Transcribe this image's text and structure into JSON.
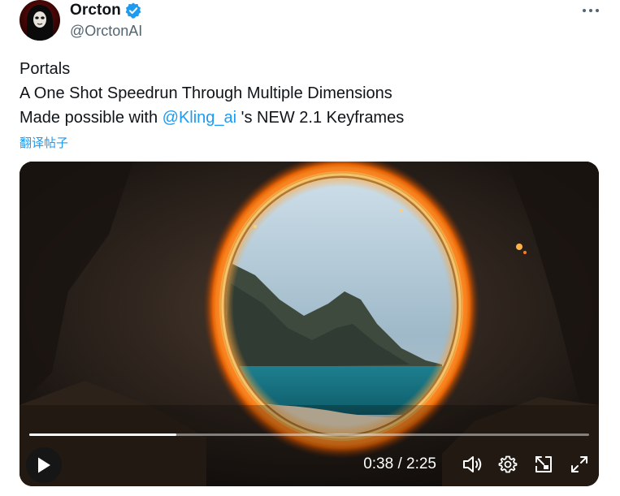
{
  "author": {
    "display_name": "Orcton",
    "handle": "@OrctonAI",
    "avatar_text": "@OrctonAI",
    "verified": true
  },
  "tweet": {
    "line1": "Portals",
    "line2": "A One Shot Speedrun Through Multiple Dimensions",
    "line3_prefix": "Made possible with ",
    "line3_mention": "@Kling_ai",
    "line3_suffix": " 's NEW 2.1 Keyframes",
    "translate_label": "翻译帖子"
  },
  "video": {
    "current_time": "0:38",
    "separator": " / ",
    "duration": "2:25",
    "progress_fraction": 0.262,
    "icons": [
      "play-icon",
      "volume-icon",
      "settings-icon",
      "pop-out-icon",
      "fullscreen-icon"
    ]
  },
  "colors": {
    "accent": "#1d9bf0",
    "text": "#0f1419",
    "secondary": "#536471"
  }
}
